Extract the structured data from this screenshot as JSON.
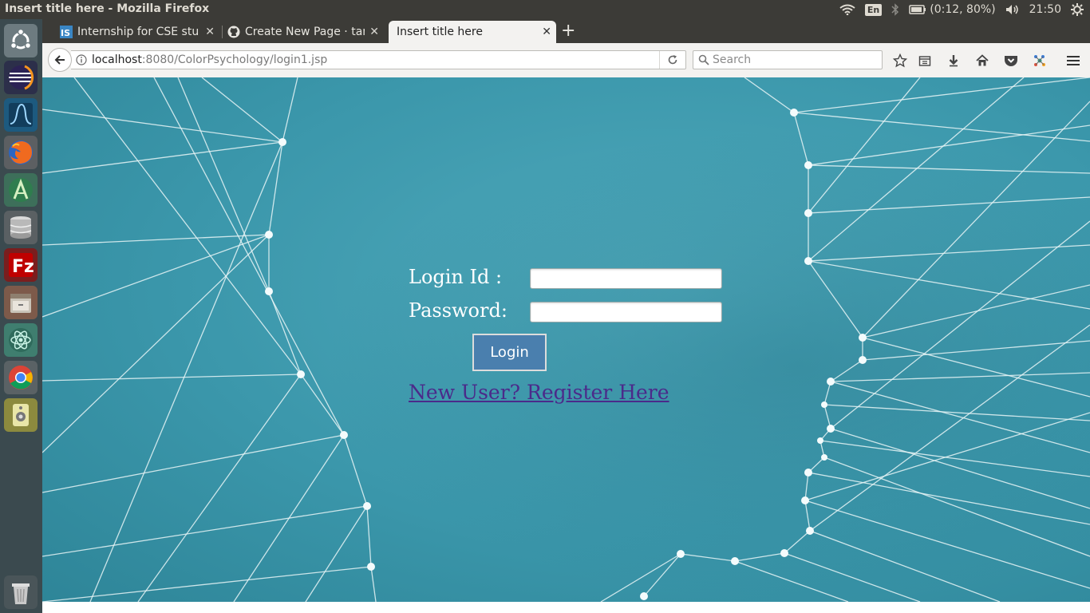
{
  "window": {
    "title": "Insert title here - Mozilla Firefox"
  },
  "system_tray": {
    "language": "En",
    "battery": "(0:12, 80%)",
    "time": "21:50"
  },
  "launcher": {
    "items": [
      {
        "name": "ubuntu-dash",
        "icon": "ubuntu-logo-icon"
      },
      {
        "name": "eclipse",
        "icon": "eclipse-icon"
      },
      {
        "name": "system-monitor",
        "icon": "waveform-icon"
      },
      {
        "name": "firefox",
        "icon": "firefox-icon"
      },
      {
        "name": "android-studio",
        "icon": "android-studio-icon"
      },
      {
        "name": "database",
        "icon": "database-icon"
      },
      {
        "name": "filezilla",
        "icon": "filezilla-icon"
      },
      {
        "name": "files",
        "icon": "file-cabinet-icon"
      },
      {
        "name": "atom",
        "icon": "atom-icon"
      },
      {
        "name": "chrome",
        "icon": "chrome-icon"
      },
      {
        "name": "speaker-app",
        "icon": "speaker-icon"
      },
      {
        "name": "trash",
        "icon": "trash-icon"
      }
    ]
  },
  "browser": {
    "tabs": [
      {
        "label": "Internship for CSE stud",
        "favicon": "IS",
        "active": false
      },
      {
        "label": "Create New Page · tani",
        "favicon": "github-icon",
        "active": false
      },
      {
        "label": "Insert title here",
        "favicon": "",
        "active": true
      }
    ],
    "url": {
      "host": "localhost",
      "rest": ":8080/ColorPsychology/login1.jsp"
    },
    "search_placeholder": "Search"
  },
  "page": {
    "login_label": "Login Id :",
    "password_label": "Password:",
    "login_value": "",
    "password_value": "",
    "login_button": "Login",
    "register_link": "New User? Register Here",
    "colors": {
      "background": "#3b97ab",
      "button": "#4a7fae",
      "link": "#4b2a8a"
    }
  }
}
